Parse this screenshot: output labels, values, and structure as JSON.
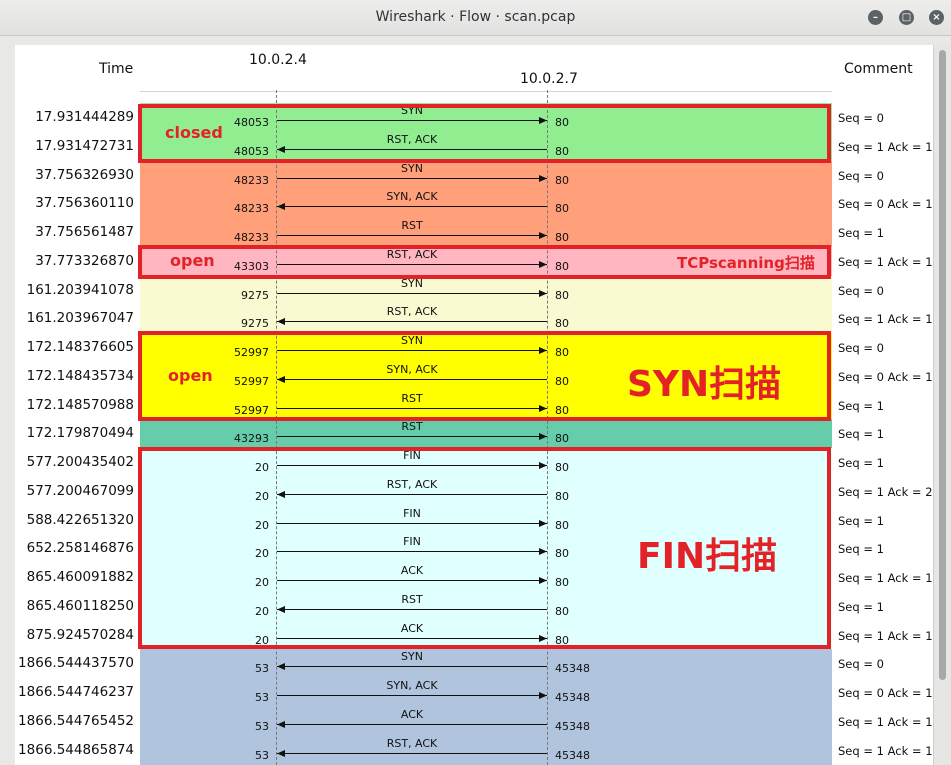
{
  "window": {
    "title": "Wireshark · Flow · scan.pcap"
  },
  "header": {
    "time_label": "Time",
    "comment_label": "Comment",
    "host_a": "10.0.2.4",
    "host_b": "10.0.2.7"
  },
  "colors": {
    "green": "#90ee90",
    "salmon": "#ffa07a",
    "pink": "#ffb6c1",
    "cream": "#fafad2",
    "yellow": "#ffff00",
    "teal": "#66cdaa",
    "cyan": "#e0ffff",
    "steel": "#b0c4de",
    "highlight": "#e32228"
  },
  "rows": [
    {
      "time": "17.931444289",
      "lport": "48053",
      "rport": "80",
      "label": "SYN",
      "dir": "right",
      "comment": "Seq = 0",
      "color": "#90ee90"
    },
    {
      "time": "17.931472731",
      "lport": "48053",
      "rport": "80",
      "label": "RST, ACK",
      "dir": "left",
      "comment": "Seq = 1 Ack = 1",
      "color": "#90ee90"
    },
    {
      "time": "37.756326930",
      "lport": "48233",
      "rport": "80",
      "label": "SYN",
      "dir": "right",
      "comment": "Seq = 0",
      "color": "#ffa07a"
    },
    {
      "time": "37.756360110",
      "lport": "48233",
      "rport": "80",
      "label": "SYN, ACK",
      "dir": "left",
      "comment": "Seq = 0 Ack = 1",
      "color": "#ffa07a"
    },
    {
      "time": "37.756561487",
      "lport": "48233",
      "rport": "80",
      "label": "RST",
      "dir": "right",
      "comment": "Seq = 1",
      "color": "#ffa07a"
    },
    {
      "time": "37.773326870",
      "lport": "43303",
      "rport": "80",
      "label": "RST, ACK",
      "dir": "right",
      "comment": "Seq = 1 Ack = 1",
      "color": "#ffb6c1"
    },
    {
      "time": "161.203941078",
      "lport": "9275",
      "rport": "80",
      "label": "SYN",
      "dir": "right",
      "comment": "Seq = 0",
      "color": "#fafad2"
    },
    {
      "time": "161.203967047",
      "lport": "9275",
      "rport": "80",
      "label": "RST, ACK",
      "dir": "left",
      "comment": "Seq = 1 Ack = 1",
      "color": "#fafad2"
    },
    {
      "time": "172.148376605",
      "lport": "52997",
      "rport": "80",
      "label": "SYN",
      "dir": "right",
      "comment": "Seq = 0",
      "color": "#ffff00"
    },
    {
      "time": "172.148435734",
      "lport": "52997",
      "rport": "80",
      "label": "SYN, ACK",
      "dir": "left",
      "comment": "Seq = 0 Ack = 1",
      "color": "#ffff00"
    },
    {
      "time": "172.148570988",
      "lport": "52997",
      "rport": "80",
      "label": "RST",
      "dir": "right",
      "comment": "Seq = 1",
      "color": "#ffff00"
    },
    {
      "time": "172.179870494",
      "lport": "43293",
      "rport": "80",
      "label": "RST",
      "dir": "right",
      "comment": "Seq = 1",
      "color": "#66cdaa"
    },
    {
      "time": "577.200435402",
      "lport": "20",
      "rport": "80",
      "label": "FIN",
      "dir": "right",
      "comment": "Seq = 1",
      "color": "#e0ffff"
    },
    {
      "time": "577.200467099",
      "lport": "20",
      "rport": "80",
      "label": "RST, ACK",
      "dir": "left",
      "comment": "Seq = 1 Ack = 2",
      "color": "#e0ffff"
    },
    {
      "time": "588.422651320",
      "lport": "20",
      "rport": "80",
      "label": "FIN",
      "dir": "right",
      "comment": "Seq = 1",
      "color": "#e0ffff"
    },
    {
      "time": "652.258146876",
      "lport": "20",
      "rport": "80",
      "label": "FIN",
      "dir": "right",
      "comment": "Seq = 1",
      "color": "#e0ffff"
    },
    {
      "time": "865.460091882",
      "lport": "20",
      "rport": "80",
      "label": "ACK",
      "dir": "right",
      "comment": "Seq = 1 Ack = 1",
      "color": "#e0ffff"
    },
    {
      "time": "865.460118250",
      "lport": "20",
      "rport": "80",
      "label": "RST",
      "dir": "left",
      "comment": "Seq = 1",
      "color": "#e0ffff"
    },
    {
      "time": "875.924570284",
      "lport": "20",
      "rport": "80",
      "label": "ACK",
      "dir": "right",
      "comment": "Seq = 1 Ack = 1",
      "color": "#e0ffff"
    },
    {
      "time": "1866.544437570",
      "lport": "53",
      "rport": "45348",
      "label": "SYN",
      "dir": "left",
      "comment": "Seq = 0",
      "color": "#b0c4de"
    },
    {
      "time": "1866.544746237",
      "lport": "53",
      "rport": "45348",
      "label": "SYN, ACK",
      "dir": "right",
      "comment": "Seq = 0 Ack = 1",
      "color": "#b0c4de"
    },
    {
      "time": "1866.544765452",
      "lport": "53",
      "rport": "45348",
      "label": "ACK",
      "dir": "left",
      "comment": "Seq = 1 Ack = 1",
      "color": "#b0c4de"
    },
    {
      "time": "1866.544865874",
      "lport": "53",
      "rport": "45348",
      "label": "RST, ACK",
      "dir": "left",
      "comment": "Seq = 1 Ack = 1",
      "color": "#b0c4de"
    }
  ],
  "annotations": {
    "closed": "closed",
    "open1": "open",
    "tcp_scan": "TCPscanning扫描",
    "open2": "open",
    "syn_scan": "SYN扫描",
    "fin_scan": "FIN扫描"
  }
}
